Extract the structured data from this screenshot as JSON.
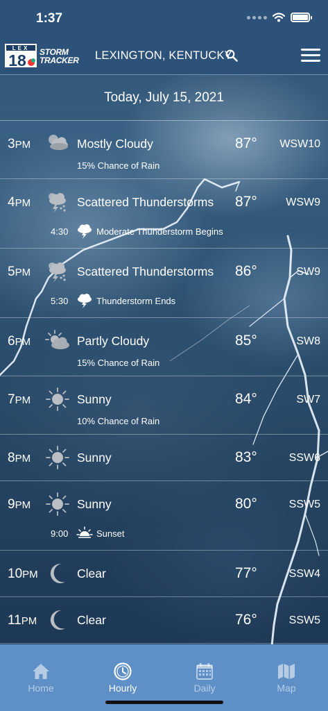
{
  "status_bar": {
    "time": "1:37"
  },
  "header": {
    "logo_text": "LEX 18",
    "brand_line1": "STORM",
    "brand_line2": "TRACKER",
    "location": "LEXINGTON, KENTUCKY"
  },
  "date_label": "Today, July 15, 2021",
  "hours": [
    {
      "hour": "3",
      "ampm": "PM",
      "icon": "mostly-cloudy-icon",
      "condition": "Mostly Cloudy",
      "temp": "87°",
      "wind": "WSW10",
      "sub": "15% Chance of Rain"
    },
    {
      "hour": "4",
      "ampm": "PM",
      "icon": "thunderstorm-icon",
      "condition": "Scattered Thunderstorms",
      "temp": "87°",
      "wind": "WSW9",
      "event_time": "4:30",
      "event_icon": "lightning-cloud-icon",
      "event_text": "Moderate Thunderstorm Begins"
    },
    {
      "hour": "5",
      "ampm": "PM",
      "icon": "thunderstorm-icon",
      "condition": "Scattered Thunderstorms",
      "temp": "86°",
      "wind": "SW9",
      "event_time": "5:30",
      "event_icon": "lightning-cloud-icon",
      "event_text": "Thunderstorm Ends"
    },
    {
      "hour": "6",
      "ampm": "PM",
      "icon": "partly-cloudy-icon",
      "condition": "Partly Cloudy",
      "temp": "85°",
      "wind": "SW8",
      "sub": "15% Chance of Rain"
    },
    {
      "hour": "7",
      "ampm": "PM",
      "icon": "sun-icon",
      "condition": "Sunny",
      "temp": "84°",
      "wind": "SW7",
      "sub": "10% Chance of Rain"
    },
    {
      "hour": "8",
      "ampm": "PM",
      "icon": "sun-icon",
      "condition": "Sunny",
      "temp": "83°",
      "wind": "SSW6"
    },
    {
      "hour": "9",
      "ampm": "PM",
      "icon": "sun-icon",
      "condition": "Sunny",
      "temp": "80°",
      "wind": "SSW5",
      "event_time": "9:00",
      "event_icon": "sunset-icon",
      "event_text": "Sunset"
    },
    {
      "hour": "10",
      "ampm": "PM",
      "icon": "moon-icon",
      "condition": "Clear",
      "temp": "77°",
      "wind": "SSW4"
    },
    {
      "hour": "11",
      "ampm": "PM",
      "icon": "moon-icon",
      "condition": "Clear",
      "temp": "76°",
      "wind": "SSW5"
    }
  ],
  "tabs": [
    {
      "label": "Home",
      "icon": "home-icon",
      "active": false
    },
    {
      "label": "Hourly",
      "icon": "clock-icon",
      "active": true
    },
    {
      "label": "Daily",
      "icon": "calendar-icon",
      "active": false
    },
    {
      "label": "Map",
      "icon": "map-icon",
      "active": false
    }
  ],
  "colors": {
    "header_bg": "#2c527a",
    "tab_bar_bg": "#5e8fc6",
    "icon_gray": "#b9bec4"
  }
}
